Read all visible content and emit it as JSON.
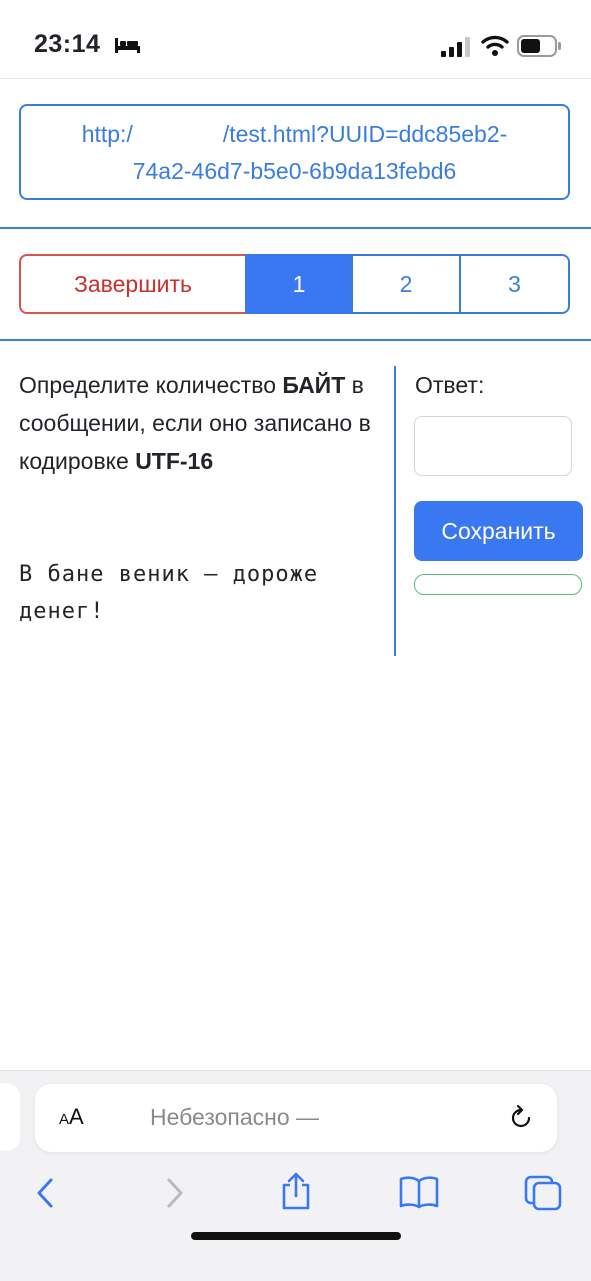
{
  "status_bar": {
    "time": "23:14"
  },
  "url_box": {
    "line1_prefix": "http:/",
    "line1_suffix": "/test.html?UUID=ddc85eb2-",
    "line2": "74a2-46d7-b5e0-6b9da13febd6"
  },
  "pager": {
    "finish_label": "Завершить",
    "pages": [
      "1",
      "2",
      "3"
    ],
    "active_page": "1"
  },
  "question": {
    "t1": "Определите количество ",
    "b1": "БАЙТ",
    "t2": " в сообщении, если оно записано в кодировке ",
    "b2": "UTF-16",
    "phrase": "В бане веник — дороже денег!"
  },
  "answer": {
    "label": "Ответ:",
    "value": "",
    "save_label": "Сохранить"
  },
  "browser": {
    "aa_big": "A",
    "aa_small": "A",
    "address_text": "Небезопасно —"
  },
  "colors": {
    "accent": "#3b7ddd",
    "danger": "#c9302c",
    "success": "#5cb87a"
  }
}
